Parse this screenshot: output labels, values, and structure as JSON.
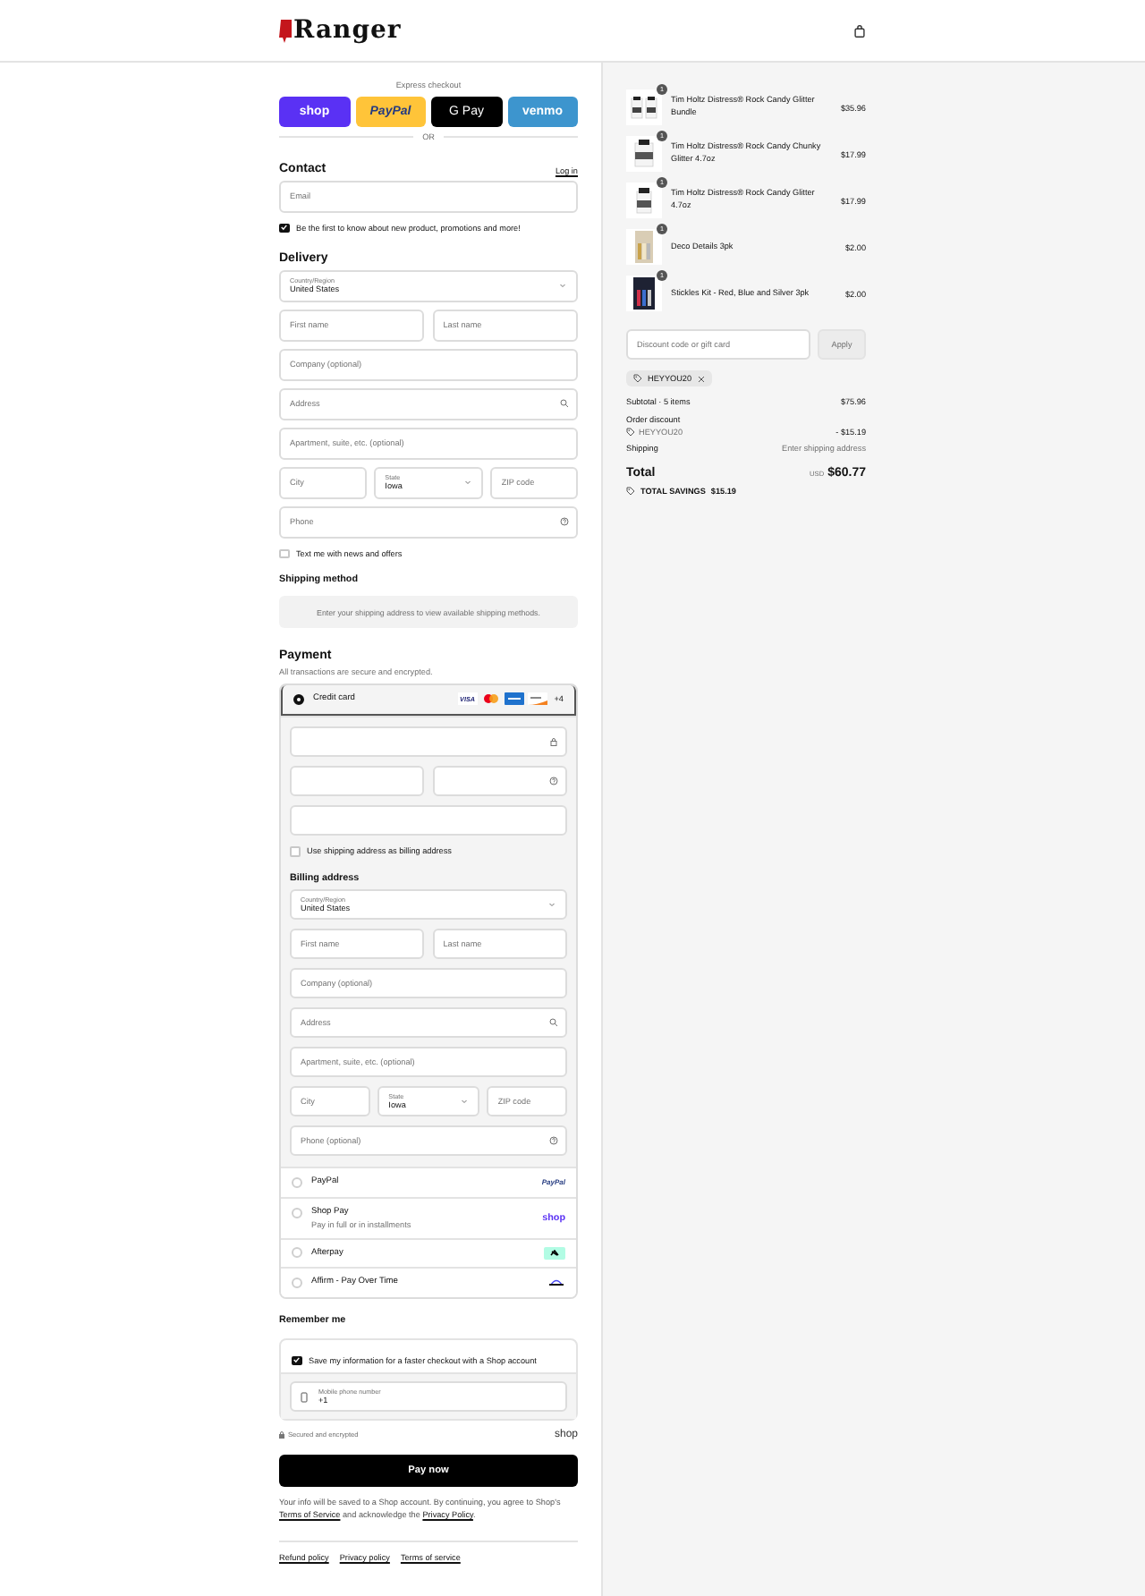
{
  "header": {
    "logo": "Ranger"
  },
  "express": {
    "label": "Express checkout",
    "buttons": [
      {
        "kind": "shop",
        "label": "shop"
      },
      {
        "kind": "paypal",
        "label": "PayPal"
      },
      {
        "kind": "gpay",
        "label": "G Pay"
      },
      {
        "kind": "venmo",
        "label": "venmo"
      }
    ],
    "divider": "OR"
  },
  "contact": {
    "title": "Contact",
    "login": "Log in",
    "email": {
      "kind": "text",
      "placeholder": "Email"
    },
    "newsletter": {
      "label": "Be the first to know about new product, promotions and more!",
      "checked": true
    }
  },
  "delivery": {
    "title": "Delivery",
    "rows": [
      [
        {
          "kind": "select",
          "label": "Country/Region",
          "value": "United States"
        }
      ],
      [
        {
          "kind": "text",
          "placeholder": "First name"
        },
        {
          "kind": "text",
          "placeholder": "Last name"
        }
      ],
      [
        {
          "kind": "text",
          "placeholder": "Company (optional)"
        }
      ],
      [
        {
          "kind": "search",
          "placeholder": "Address"
        }
      ],
      [
        {
          "kind": "text",
          "placeholder": "Apartment, suite, etc. (optional)"
        }
      ],
      [
        {
          "kind": "text",
          "placeholder": "City"
        },
        {
          "kind": "select",
          "label": "State",
          "value": "Iowa"
        },
        {
          "kind": "text",
          "placeholder": "ZIP code"
        }
      ],
      [
        {
          "kind": "help",
          "placeholder": "Phone"
        }
      ]
    ],
    "sms": {
      "label": "Text me with news and offers",
      "checked": false
    }
  },
  "shipping": {
    "title": "Shipping method",
    "notice": "Enter your shipping address to view available shipping methods."
  },
  "payment": {
    "title": "Payment",
    "subtitle": "All transactions are secure and encrypted.",
    "methods": [
      {
        "kind": "card",
        "label": "Credit card",
        "selected": true,
        "brands": [
          {
            "kind": "visa",
            "label": "VISA"
          },
          {
            "kind": "mastercard"
          },
          {
            "kind": "amex"
          },
          {
            "kind": "discover"
          }
        ],
        "more": "+4",
        "rows": [
          [
            {
              "kind": "lock"
            }
          ],
          [
            {
              "kind": "text"
            },
            {
              "kind": "help"
            }
          ],
          [
            {
              "kind": "text"
            }
          ]
        ],
        "same_address": {
          "label": "Use shipping address as billing address",
          "checked": false
        },
        "billing": {
          "title": "Billing address",
          "rows": [
            [
              {
                "kind": "select",
                "label": "Country/Region",
                "value": "United States"
              }
            ],
            [
              {
                "kind": "text",
                "placeholder": "First name"
              },
              {
                "kind": "text",
                "placeholder": "Last name"
              }
            ],
            [
              {
                "kind": "text",
                "placeholder": "Company (optional)"
              }
            ],
            [
              {
                "kind": "search",
                "placeholder": "Address"
              }
            ],
            [
              {
                "kind": "text",
                "placeholder": "Apartment, suite, etc. (optional)"
              }
            ],
            [
              {
                "kind": "text",
                "placeholder": "City"
              },
              {
                "kind": "select",
                "label": "State",
                "value": "Iowa"
              },
              {
                "kind": "text",
                "placeholder": "ZIP code"
              }
            ],
            [
              {
                "kind": "help",
                "placeholder": "Phone (optional)"
              }
            ]
          ]
        }
      },
      {
        "kind": "paypal",
        "label": "PayPal",
        "selected": false,
        "logo": "PayPal"
      },
      {
        "kind": "shop",
        "label": "Shop Pay",
        "sublabel": "Pay in full or in installments",
        "selected": false,
        "logo": "shop"
      },
      {
        "kind": "afterpay",
        "label": "Afterpay",
        "selected": false
      },
      {
        "kind": "affirm",
        "label": "Affirm - Pay Over Time",
        "selected": false
      }
    ]
  },
  "remember": {
    "title": "Remember me",
    "save": {
      "label": "Save my information for a faster checkout with a Shop account",
      "checked": true
    },
    "phone": {
      "label": "Mobile phone number",
      "value": "+1"
    },
    "secured": "Secured and encrypted",
    "logo": "shop"
  },
  "pay_button": "Pay now",
  "consent": {
    "before": "Your info will be saved to a Shop account. By continuing, you agree to Shop's",
    "terms": "Terms of Service",
    "middle": "and acknowledge the",
    "privacy": "Privacy Policy",
    "after": "."
  },
  "footer_links": [
    "Refund policy",
    "Privacy policy",
    "Terms of service"
  ],
  "summary": {
    "items": [
      {
        "name": "Tim Holtz Distress® Rock Candy Glitter Bundle",
        "price": "$35.96",
        "quantity": "1"
      },
      {
        "name": "Tim Holtz Distress® Rock Candy Chunky Glitter 4.7oz",
        "price": "$17.99",
        "quantity": "1"
      },
      {
        "name": "Tim Holtz Distress® Rock Candy Glitter 4.7oz",
        "price": "$17.99",
        "quantity": "1"
      },
      {
        "name": "Deco Details 3pk",
        "price": "$2.00",
        "quantity": "1"
      },
      {
        "name": "Stickles Kit - Red, Blue and Silver 3pk",
        "price": "$2.00",
        "quantity": "1"
      }
    ],
    "discount": {
      "placeholder": "Discount code or gift card",
      "button": "Apply"
    },
    "code_tag": "HEYYOU20",
    "subtotal_label": "Subtotal · 5 items",
    "subtotal": "$75.96",
    "order_discount": "Order discount",
    "code": "HEYYOU20",
    "discount_value": "- $15.19",
    "shipping_label": "Shipping",
    "shipping_value": "Enter shipping address",
    "total_label": "Total",
    "currency": "USD",
    "total": "$60.77",
    "savings_label": "TOTAL SAVINGS",
    "savings": "$15.19"
  }
}
